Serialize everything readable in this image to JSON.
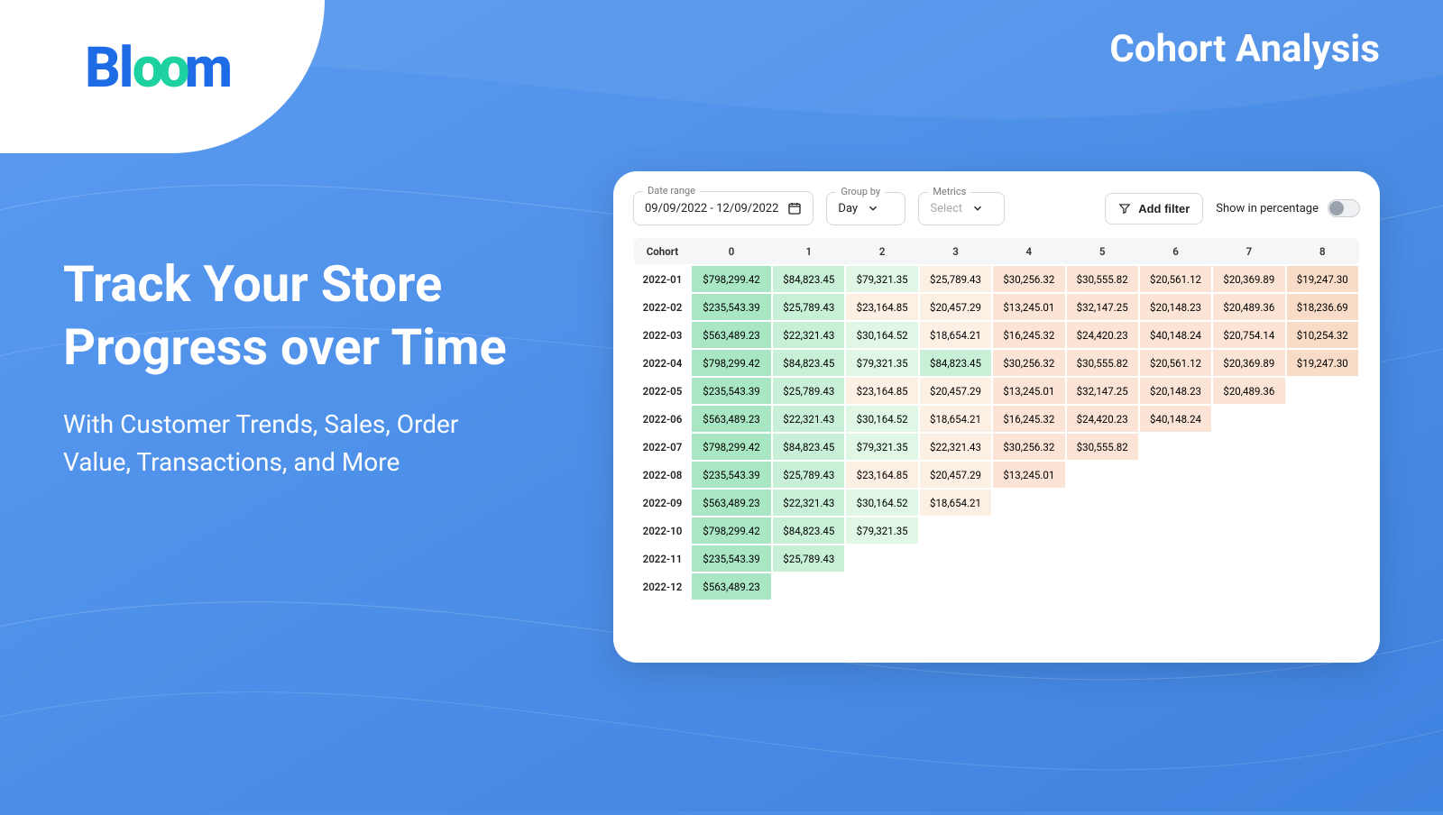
{
  "brand": "Bloom",
  "page_title": "Cohort Analysis",
  "hero": {
    "heading": "Track Your  Store Progress over Time",
    "sub": "With Customer Trends, Sales, Order Value, Transactions, and More"
  },
  "controls": {
    "date_range": {
      "legend": "Date range",
      "value": "09/09/2022 - 12/09/2022"
    },
    "group_by": {
      "legend": "Group by",
      "value": "Day"
    },
    "metrics": {
      "legend": "Metrics",
      "placeholder": "Select"
    },
    "add_filter_label": "Add filter",
    "show_pct_label": "Show in percentage"
  },
  "chart_data": {
    "type": "table",
    "title": "Cohort Analysis",
    "header_label": "Cohort",
    "columns": [
      "0",
      "1",
      "2",
      "3",
      "4",
      "5",
      "6",
      "7",
      "8"
    ],
    "rows": [
      {
        "cohort": "2022-01",
        "values": [
          "$798,299.42",
          "$84,823.45",
          "$79,321.35",
          "$25,789.43",
          "$30,256.32",
          "$30,555.82",
          "$20,561.12",
          "$20,369.89",
          "$19,247.30"
        ]
      },
      {
        "cohort": "2022-02",
        "values": [
          "$235,543.39",
          "$25,789.43",
          "$23,164.85",
          "$20,457.29",
          "$13,245.01",
          "$32,147.25",
          "$20,148.23",
          "$20,489.36",
          "$18,236.69"
        ]
      },
      {
        "cohort": "2022-03",
        "values": [
          "$563,489.23",
          "$22,321.43",
          "$30,164.52",
          "$18,654.21",
          "$16,245.32",
          "$24,420.23",
          "$40,148.24",
          "$20,754.14",
          "$10,254.32"
        ]
      },
      {
        "cohort": "2022-04",
        "values": [
          "$798,299.42",
          "$84,823.45",
          "$79,321.35",
          "$84,823.45",
          "$30,256.32",
          "$30,555.82",
          "$20,561.12",
          "$20,369.89",
          "$19,247.30"
        ]
      },
      {
        "cohort": "2022-05",
        "values": [
          "$235,543.39",
          "$25,789.43",
          "$23,164.85",
          "$20,457.29",
          "$13,245.01",
          "$32,147.25",
          "$20,148.23",
          "$20,489.36"
        ]
      },
      {
        "cohort": "2022-06",
        "values": [
          "$563,489.23",
          "$22,321.43",
          "$30,164.52",
          "$18,654.21",
          "$16,245.32",
          "$24,420.23",
          "$40,148.24"
        ]
      },
      {
        "cohort": "2022-07",
        "values": [
          "$798,299.42",
          "$84,823.45",
          "$79,321.35",
          "$22,321.43",
          "$30,256.32",
          "$30,555.82"
        ]
      },
      {
        "cohort": "2022-08",
        "values": [
          "$235,543.39",
          "$25,789.43",
          "$23,164.85",
          "$20,457.29",
          "$13,245.01"
        ]
      },
      {
        "cohort": "2022-09",
        "values": [
          "$563,489.23",
          "$22,321.43",
          "$30,164.52",
          "$18,654.21"
        ]
      },
      {
        "cohort": "2022-10",
        "values": [
          "$798,299.42",
          "$84,823.45",
          "$79,321.35"
        ]
      },
      {
        "cohort": "2022-11",
        "values": [
          "$235,543.39",
          "$25,789.43"
        ]
      },
      {
        "cohort": "2022-12",
        "values": [
          "$563,489.23"
        ]
      }
    ],
    "tints": [
      [
        0,
        1,
        2,
        3,
        4,
        4,
        4,
        4,
        5
      ],
      [
        0,
        1,
        3,
        3,
        4,
        4,
        4,
        4,
        5
      ],
      [
        0,
        1,
        2,
        3,
        4,
        4,
        4,
        4,
        5
      ],
      [
        0,
        1,
        2,
        1,
        4,
        4,
        4,
        4,
        5
      ],
      [
        0,
        1,
        3,
        3,
        4,
        4,
        4,
        4
      ],
      [
        0,
        1,
        2,
        3,
        4,
        4,
        4
      ],
      [
        0,
        1,
        2,
        3,
        4,
        4
      ],
      [
        0,
        1,
        3,
        3,
        4
      ],
      [
        0,
        1,
        2,
        3
      ],
      [
        0,
        1,
        2
      ],
      [
        0,
        1
      ],
      [
        0
      ]
    ]
  }
}
